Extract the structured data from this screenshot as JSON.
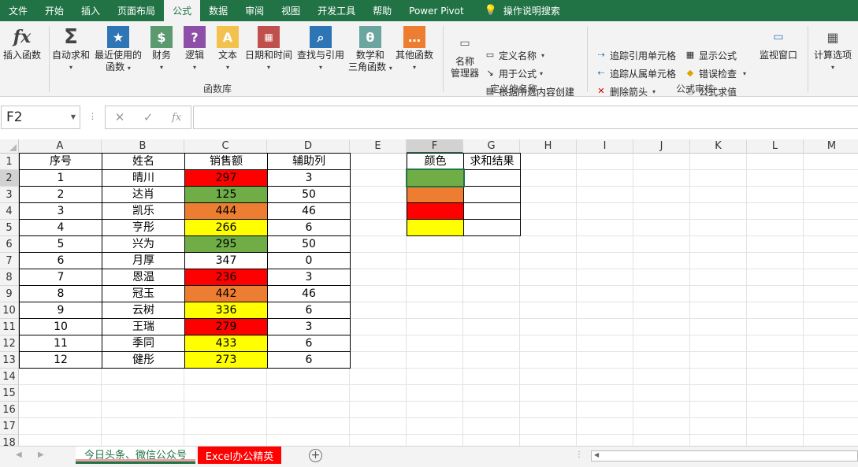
{
  "tabs": [
    "文件",
    "开始",
    "插入",
    "页面布局",
    "公式",
    "数据",
    "审阅",
    "视图",
    "开发工具",
    "帮助",
    "Power Pivot",
    "操作说明搜索"
  ],
  "active_tab_index": 4,
  "ribbon": {
    "insert_function": "插入函数",
    "autosum": "自动求和",
    "recent_line1": "最近使用的",
    "recent_line2": "函数",
    "financial": "财务",
    "logical": "逻辑",
    "text": "文本",
    "datetime": "日期和时间",
    "lookup": "查找与引用",
    "math_line1": "数学和",
    "math_line2": "三角函数",
    "other": "其他函数",
    "function_library_label": "函数库",
    "name_manager_line1": "名称",
    "name_manager_line2": "管理器",
    "define_name": "定义名称",
    "use_in_formula": "用于公式",
    "create_from_selection": "根据所选内容创建",
    "defined_names_label": "定义的名称",
    "trace_precedents": "追踪引用单元格",
    "trace_dependents": "追踪从属单元格",
    "remove_arrows": "删除箭头",
    "show_formulas": "显示公式",
    "error_checking": "错误检查",
    "evaluate_formula": "公式求值",
    "watch_window": "监视窗口",
    "formula_auditing_label": "公式审核",
    "calc_options": "计算选项"
  },
  "formula_bar": {
    "name_box": "F2",
    "cancel": "✕",
    "enter": "✓",
    "fx": "fx",
    "content": ""
  },
  "columns": [
    "A",
    "B",
    "C",
    "D",
    "E",
    "F",
    "G",
    "H",
    "I",
    "J",
    "K",
    "L",
    "M"
  ],
  "rows": [
    "1",
    "2",
    "3",
    "4",
    "5",
    "6",
    "7",
    "8",
    "9",
    "10",
    "11",
    "12",
    "13",
    "14",
    "15",
    "16",
    "17",
    "18"
  ],
  "colors": {
    "red": "#FF0000",
    "green": "#70AD47",
    "orange": "#ED7D31",
    "yellow": "#FFFF00",
    "white": "#FFFFFF",
    "excel_green": "#217346"
  },
  "table": {
    "headers": [
      "序号",
      "姓名",
      "销售额",
      "辅助列"
    ],
    "rows": [
      {
        "seq": "1",
        "name": "晴川",
        "sales": "297",
        "aux": "3",
        "fill": "red"
      },
      {
        "seq": "2",
        "name": "达肖",
        "sales": "125",
        "aux": "50",
        "fill": "green"
      },
      {
        "seq": "3",
        "name": "凯乐",
        "sales": "444",
        "aux": "46",
        "fill": "orange"
      },
      {
        "seq": "4",
        "name": "亨彤",
        "sales": "266",
        "aux": "6",
        "fill": "yellow"
      },
      {
        "seq": "5",
        "name": "兴为",
        "sales": "295",
        "aux": "50",
        "fill": "green"
      },
      {
        "seq": "6",
        "name": "月厚",
        "sales": "347",
        "aux": "0",
        "fill": "white"
      },
      {
        "seq": "7",
        "name": "恩温",
        "sales": "236",
        "aux": "3",
        "fill": "red"
      },
      {
        "seq": "8",
        "name": "冠玉",
        "sales": "442",
        "aux": "46",
        "fill": "orange"
      },
      {
        "seq": "9",
        "name": "云树",
        "sales": "336",
        "aux": "6",
        "fill": "yellow"
      },
      {
        "seq": "10",
        "name": "王瑞",
        "sales": "279",
        "aux": "3",
        "fill": "red"
      },
      {
        "seq": "11",
        "name": "季同",
        "sales": "433",
        "aux": "6",
        "fill": "yellow"
      },
      {
        "seq": "12",
        "name": "健彤",
        "sales": "273",
        "aux": "6",
        "fill": "yellow"
      }
    ]
  },
  "summary": {
    "headers": [
      "颜色",
      "求和结果"
    ],
    "rows": [
      {
        "fill": "green",
        "result": ""
      },
      {
        "fill": "orange",
        "result": ""
      },
      {
        "fill": "red",
        "result": ""
      },
      {
        "fill": "yellow",
        "result": ""
      }
    ]
  },
  "sheets": [
    {
      "label": "今日头条、微信公众号",
      "active": false
    },
    {
      "label": "Excel办公精英",
      "active": true
    }
  ]
}
